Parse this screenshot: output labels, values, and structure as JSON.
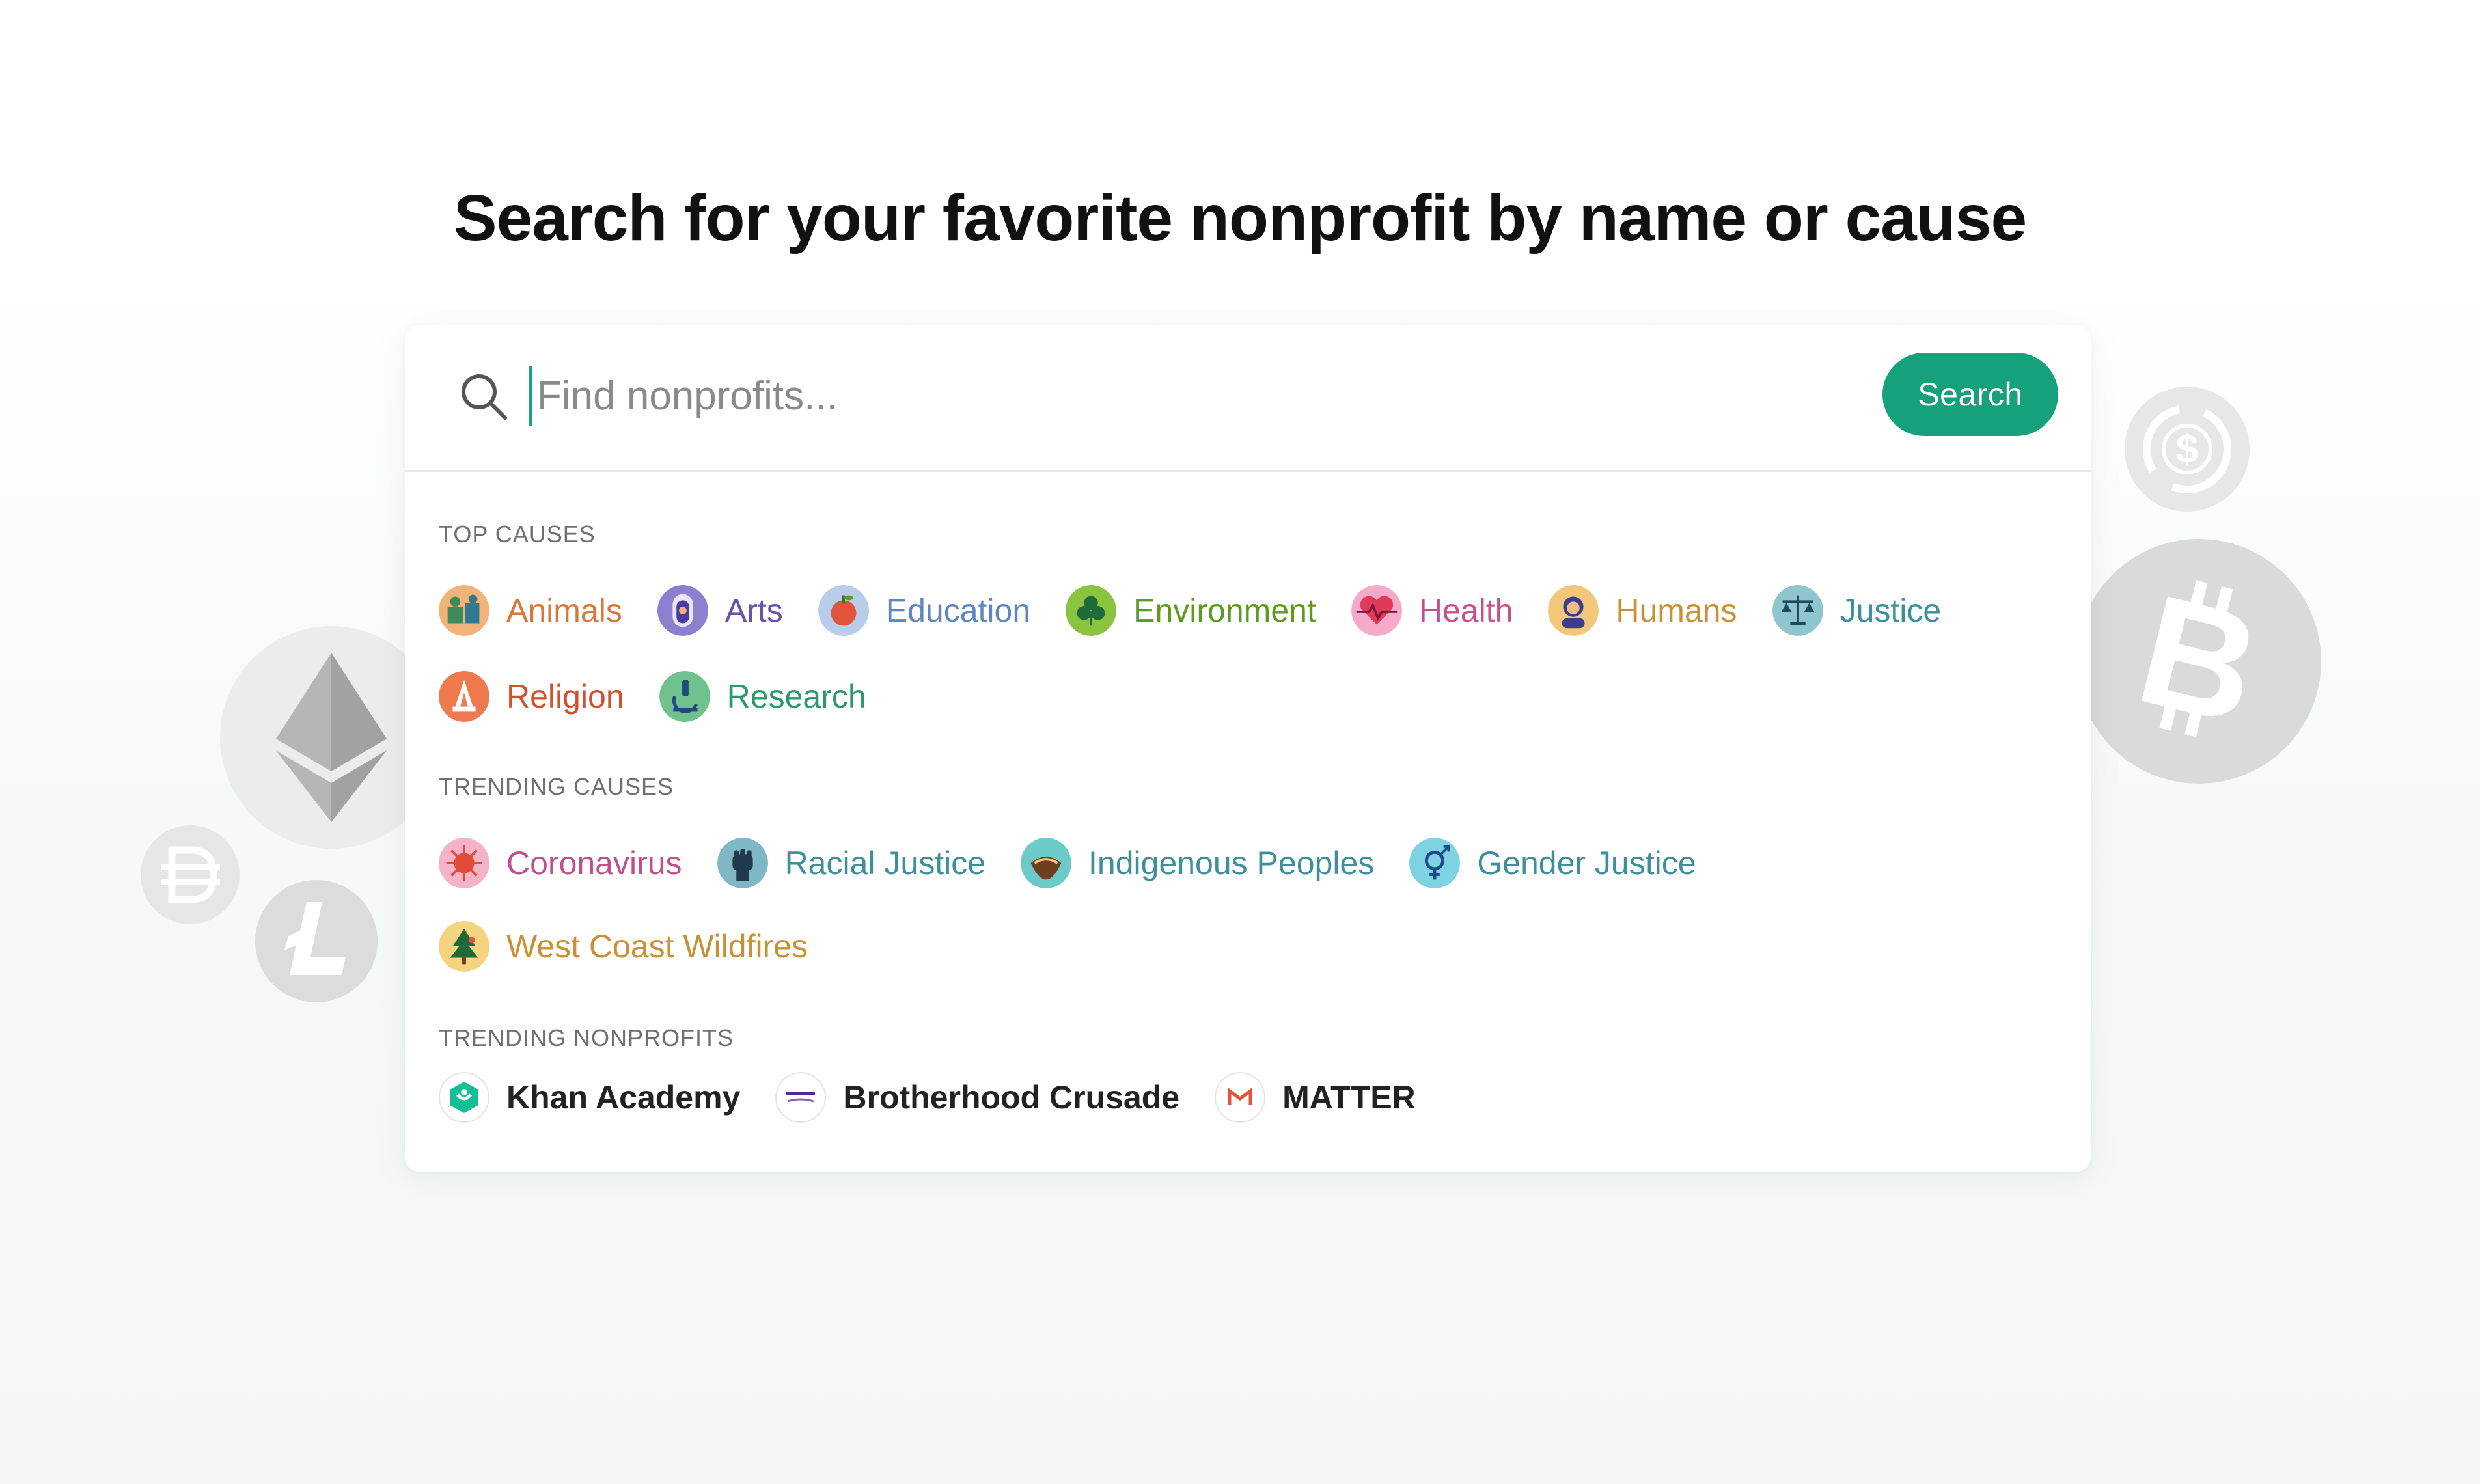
{
  "headline": "Search for your favorite nonprofit by name or cause",
  "search": {
    "placeholder": "Find nonprofits...",
    "value": "",
    "button_label": "Search"
  },
  "top_causes": {
    "title": "TOP CAUSES",
    "items": [
      {
        "label": "Animals",
        "color": "#d8793b",
        "icon": "animals-icon"
      },
      {
        "label": "Arts",
        "color": "#6a52a8",
        "icon": "arts-icon"
      },
      {
        "label": "Education",
        "color": "#5f86bf",
        "icon": "education-icon"
      },
      {
        "label": "Environment",
        "color": "#5e9a1f",
        "icon": "environment-icon"
      },
      {
        "label": "Health",
        "color": "#c84f8e",
        "icon": "health-icon"
      },
      {
        "label": "Humans",
        "color": "#c99034",
        "icon": "humans-icon"
      },
      {
        "label": "Justice",
        "color": "#3e8f9c",
        "icon": "justice-icon"
      },
      {
        "label": "Religion",
        "color": "#d0512c",
        "icon": "religion-icon"
      },
      {
        "label": "Research",
        "color": "#2a9a6a",
        "icon": "research-icon"
      }
    ]
  },
  "trending_causes": {
    "title": "TRENDING CAUSES",
    "items": [
      {
        "label": "Coronavirus",
        "color": "#c0508c",
        "icon": "coronavirus-icon"
      },
      {
        "label": "Racial Justice",
        "color": "#3e8f9c",
        "icon": "racial-justice-icon"
      },
      {
        "label": "Indigenous Peoples",
        "color": "#3e8f9c",
        "icon": "indigenous-peoples-icon"
      },
      {
        "label": "Gender Justice",
        "color": "#3e8f9c",
        "icon": "gender-justice-icon"
      },
      {
        "label": "West Coast Wildfires",
        "color": "#c99034",
        "icon": "west-coast-wildfires-icon"
      }
    ]
  },
  "trending_nonprofits": {
    "title": "TRENDING NONPROFITS",
    "items": [
      {
        "label": "Khan Academy",
        "icon": "khan-academy-logo"
      },
      {
        "label": "Brotherhood Crusade",
        "icon": "brotherhood-crusade-logo"
      },
      {
        "label": "MATTER",
        "icon": "matter-logo"
      }
    ]
  },
  "colors": {
    "accent": "#14a17c",
    "section_title": "#6f6f6f",
    "coin_fill": "#dadada"
  },
  "decorations": [
    "ethereum-coin-icon",
    "dai-coin-icon",
    "litecoin-coin-icon",
    "usdc-coin-icon",
    "bitcoin-coin-icon"
  ]
}
